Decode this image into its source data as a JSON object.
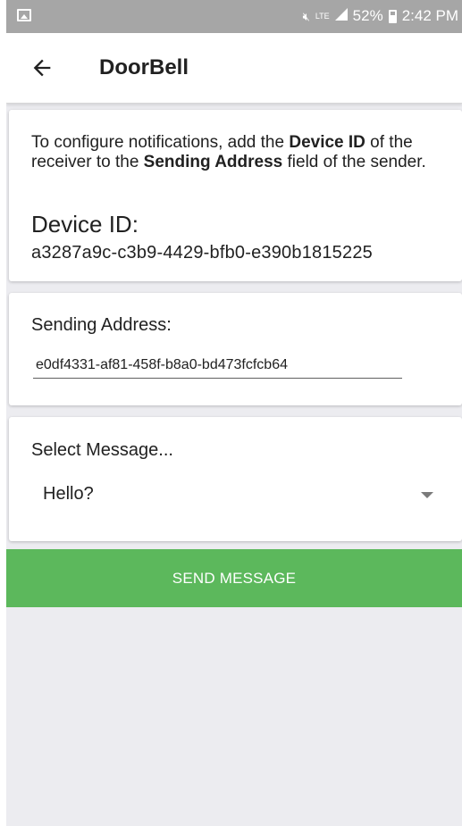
{
  "status_bar": {
    "notification_icon": "image-icon",
    "mute_icon": "muted-speaker-icon",
    "network_badge": "LTE",
    "signal_icon": "signal-icon",
    "battery_percent": "52%",
    "battery_icon": "battery-charging-icon",
    "time": "2:42 PM"
  },
  "app_bar": {
    "back_icon": "arrow-left-icon",
    "title": "DoorBell"
  },
  "config_card": {
    "intro_part1": "To configure notifications, add the ",
    "intro_bold1": "Device ID",
    "intro_part2": " of the receiver to the ",
    "intro_bold2": "Sending Address",
    "intro_part3": " field of the sender.",
    "device_id_label": "Device ID:",
    "device_id_value": "a3287a9c-c3b9-4429-bfb0-e390b1815225"
  },
  "address_card": {
    "label": "Sending Address:",
    "value": "e0df4331-af81-458f-b8a0-bd473fcfcb64"
  },
  "message_card": {
    "label": "Select Message...",
    "selected": "Hello?",
    "dropdown_icon": "caret-down-icon"
  },
  "send_button": {
    "label": "SEND MESSAGE",
    "color": "#5cb85c"
  },
  "colors": {
    "status_bar_bg": "#a6a6a6",
    "page_bg": "#ececf0",
    "card_bg": "#ffffff"
  }
}
